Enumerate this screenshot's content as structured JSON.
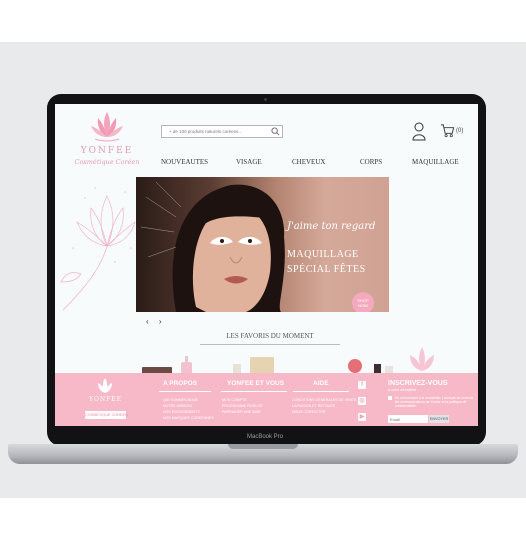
{
  "brand": {
    "name": "YONFEE",
    "tagline": "Cosmétique Coréen",
    "accent": "#f4a9be",
    "footer_tag": "COSMETIQUE COREEN"
  },
  "search": {
    "placeholder": "+ de 100 produits naturels coréens..."
  },
  "header": {
    "cart_count": "(0)"
  },
  "nav": [
    "NOUVEAUTES",
    "VISAGE",
    "CHEVEUX",
    "CORPS",
    "MAQUILLAGE"
  ],
  "hero": {
    "tagline": "J'aime ton regard",
    "title_line1": "MAQUILLAGE",
    "title_line2": "SPÉCIAL FÊTES",
    "cta": "SHOP NOW"
  },
  "carousel": {
    "prev": "‹",
    "next": "›"
  },
  "favorites": {
    "title": "LES FAVORIS DU MOMENT"
  },
  "footer": {
    "columns": [
      {
        "heading": "A PROPOS",
        "links": [
          "QUI SOMMES-NOUS",
          "NOTRE MISSION",
          "NOS ENGAGEMENTS",
          "NOS MARQUES CORÉENNES"
        ]
      },
      {
        "heading": "YONFEE ET VOUS",
        "links": [
          "MON COMPTE",
          "PROGRAMME FIDÉLITÉ",
          "PARRAINER UNE AMIE"
        ]
      },
      {
        "heading": "AIDE",
        "links": [
          "CONDITIONS GÉNÉRALES DE VENTE",
          "LIVRAISON ET RETOURS",
          "NOUS CONTACTER"
        ]
      }
    ],
    "social": [
      "f",
      "◎",
      "▶"
    ],
    "newsletter": {
      "heading": "INSCRIVEZ-VOUS",
      "subtitle": "à notre newsletter",
      "consent": "En m'inscrivant à la newsletter, j'accepte de recevoir les communications de Yonfee et la politique de confidentialité.",
      "email_placeholder": "Email",
      "button": "ENVOYER"
    }
  },
  "laptop": {
    "model": "MacBook Pro"
  }
}
